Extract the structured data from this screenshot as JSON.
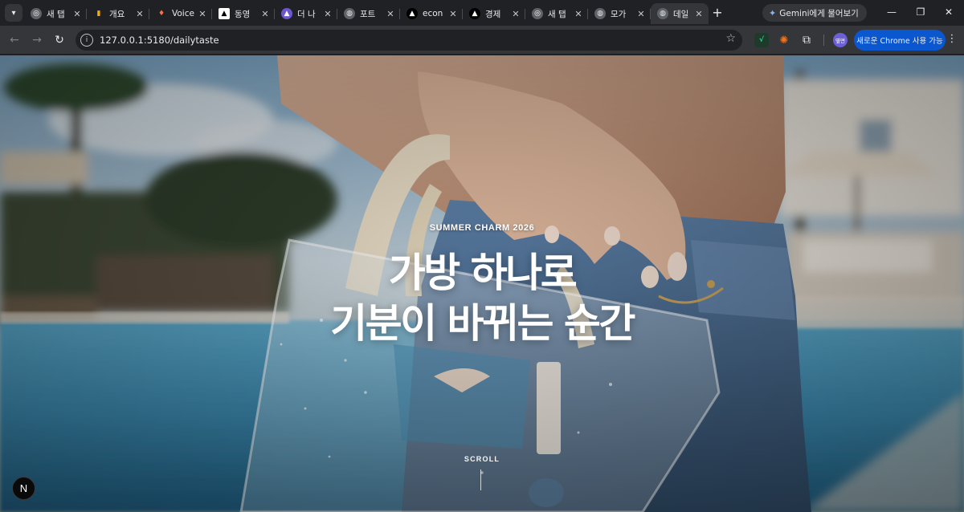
{
  "browser": {
    "tabs": [
      {
        "title": "새 탭",
        "favicon": "chrome-icon",
        "active": false
      },
      {
        "title": "개요",
        "favicon": "analytics-icon",
        "active": false
      },
      {
        "title": "Voice",
        "favicon": "fire-icon",
        "active": false
      },
      {
        "title": "동영",
        "favicon": "app-icon",
        "active": false
      },
      {
        "title": "더 나",
        "favicon": "purple-logo-icon",
        "active": false
      },
      {
        "title": "포트",
        "favicon": "globe-icon",
        "active": false
      },
      {
        "title": "econ",
        "favicon": "triangle-logo-icon",
        "active": false
      },
      {
        "title": "경제",
        "favicon": "triangle-logo-icon",
        "active": false
      },
      {
        "title": "새 탭",
        "favicon": "chrome-icon",
        "active": false
      },
      {
        "title": "모가",
        "favicon": "globe-icon",
        "active": false
      },
      {
        "title": "데일",
        "favicon": "globe-icon",
        "active": true
      }
    ],
    "gemini_label": "Gemini에게 물어보기",
    "url": "127.0.0.1:5180/dailytaste",
    "profile_label": "옆면",
    "update_label": "새로운 Chrome 사용 가능"
  },
  "hero": {
    "eyebrow": "SUMMER CHARM 2026",
    "title_line1": "가방 하나로",
    "title_line2": "기분이 바뀌는 순간",
    "scroll_label": "SCROLL"
  },
  "dev_badge": "N",
  "colors": {
    "browser_bg": "#202124",
    "toolbar_bg": "#35363a",
    "accent_blue": "#0b57d0",
    "pool_blue": "#3f8fb4",
    "denim": "#4a6d93"
  }
}
